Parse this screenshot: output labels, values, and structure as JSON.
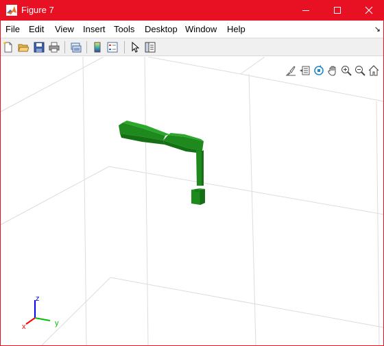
{
  "window": {
    "title": "Figure 7",
    "controls": [
      "minimize",
      "maximize",
      "close"
    ],
    "accent_color": "#e81123"
  },
  "menubar": {
    "items": [
      "File",
      "Edit",
      "View",
      "Insert",
      "Tools",
      "Desktop",
      "Window",
      "Help"
    ],
    "dock_arrow": "↘"
  },
  "toolbar": {
    "buttons": [
      "new-figure-icon",
      "open-file-icon",
      "save-icon",
      "print-icon",
      "link-plot-icon",
      "insert-colorbar-icon",
      "insert-legend-icon",
      "edit-plot-arrow-icon",
      "open-property-inspector-icon"
    ]
  },
  "axes_toolbar": {
    "buttons": [
      "brush-icon",
      "data-tips-icon",
      "rotate-3d-icon",
      "pan-icon",
      "zoom-in-icon",
      "zoom-out-icon",
      "home-icon"
    ]
  },
  "axes": {
    "triad": {
      "x": "x",
      "y": "y",
      "z": "z"
    },
    "grid": true,
    "object_color": "#1e8a1e"
  }
}
